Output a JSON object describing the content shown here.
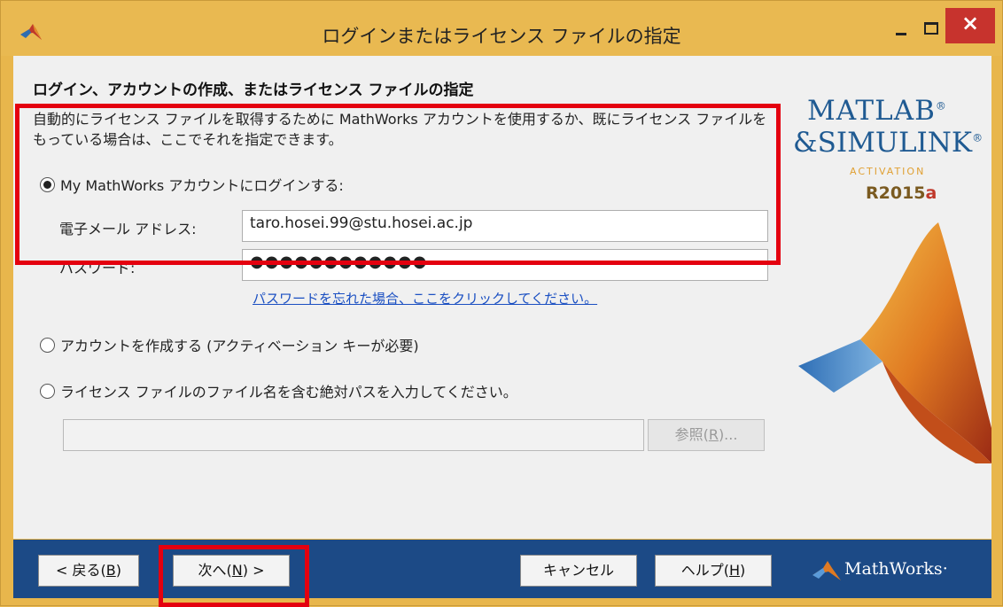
{
  "window": {
    "title": "ログインまたはライセンス ファイルの指定",
    "controls": {
      "minimize": "-",
      "maximize": "□",
      "close": "×"
    }
  },
  "content": {
    "heading": "ログイン、アカウントの作成、またはライセンス ファイルの指定",
    "description_line1": "自動的にライセンス ファイルを取得するために MathWorks アカウントを使用するか、既にライセンス ファイルを",
    "description_line2": "もっている場合は、ここでそれを指定できます。"
  },
  "options": {
    "login": {
      "label": "My MathWorks アカウントにログインする:",
      "selected": true,
      "email_label": "電子メール アドレス:",
      "email_value": "taro.hosei.99@stu.hosei.ac.jp",
      "password_label": "パスワード:",
      "password_value": "●●●●●●●●●●●●",
      "forgot_link": "パスワードを忘れた場合、ここをクリックしてください。"
    },
    "create_account": {
      "label": "アカウントを作成する (アクティベーション キーが必要)",
      "selected": false
    },
    "license_file": {
      "label": "ライセンス ファイルのファイル名を含む絶対パスを入力してください。",
      "selected": false,
      "path_value": "",
      "browse_label_prefix": "参照(",
      "browse_label_key": "R",
      "browse_label_suffix": ")..."
    }
  },
  "branding": {
    "line1": "MATLAB",
    "line2": "&SIMULINK",
    "reg": "®",
    "activation": "ACTIVATION",
    "release_prefix": "R2015",
    "release_suffix": "a"
  },
  "footer": {
    "back": {
      "prefix": "< 戻る(",
      "key": "B",
      "suffix": ")"
    },
    "next": {
      "prefix": "次へ(",
      "key": "N",
      "suffix": ") >"
    },
    "cancel": "キャンセル",
    "help": {
      "prefix": "ヘルプ(",
      "key": "H",
      "suffix": ")"
    },
    "logo_text": "MathWorks",
    "logo_reg": "·"
  },
  "colors": {
    "title_bar": "#e9b951",
    "content_bg": "#f0f0f0",
    "footer_bg": "#1c4a86",
    "highlight": "#e4000f",
    "link": "#1a4fc2"
  },
  "icons": [
    "matlab-logo-icon",
    "minimize-icon",
    "maximize-icon",
    "close-icon",
    "matlab-peak-icon",
    "mathworks-logo-icon"
  ]
}
